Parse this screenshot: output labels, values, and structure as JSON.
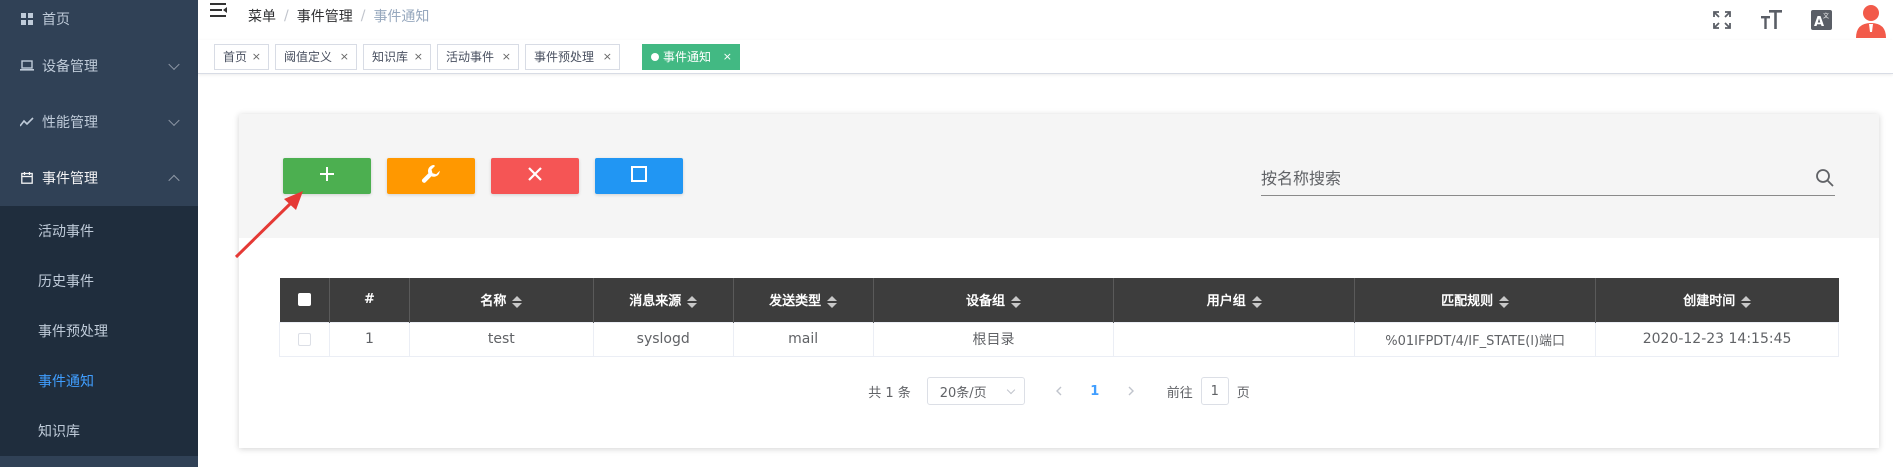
{
  "sidebar": {
    "items": [
      {
        "label": "首页",
        "icon": "dashboard-icon"
      },
      {
        "label": "设备管理",
        "icon": "laptop-icon"
      },
      {
        "label": "性能管理",
        "icon": "trend-chart-icon"
      },
      {
        "label": "事件管理",
        "icon": "calendar-icon"
      }
    ],
    "submenu": [
      {
        "label": "活动事件"
      },
      {
        "label": "历史事件"
      },
      {
        "label": "事件预处理"
      },
      {
        "label": "事件通知"
      },
      {
        "label": "知识库"
      }
    ]
  },
  "breadcrumb": {
    "menu": "菜单",
    "section": "事件管理",
    "current": "事件通知",
    "sep": "/"
  },
  "tags": [
    {
      "label": "首页"
    },
    {
      "label": "阈值定义"
    },
    {
      "label": "知识库"
    },
    {
      "label": "活动事件"
    },
    {
      "label": "事件预处理"
    },
    {
      "label": "事件通知"
    }
  ],
  "tag_close": "×",
  "search": {
    "placeholder": "按名称搜索"
  },
  "table": {
    "headers": [
      "#",
      "名称",
      "消息来源",
      "发送类型",
      "设备组",
      "用户组",
      "匹配规则",
      "创建时间"
    ],
    "rows": [
      [
        "1",
        "test",
        "syslogd",
        "mail",
        "根目录",
        "",
        "%01IFPDT/4/IF_STATE(l)端口",
        "2020-12-23 14:15:45"
      ]
    ]
  },
  "pagination": {
    "total": "共 1 条",
    "page_size": "20条/页",
    "current": "1",
    "goto_prefix": "前往",
    "goto_value": "1",
    "goto_suffix": "页"
  },
  "colors": {
    "sidebar_bg": "#304156",
    "active_tag": "#42b983",
    "add": "#4caf50",
    "edit": "#ff9800",
    "delete": "#f55555",
    "stop": "#2196f3",
    "annotation": "#e53935"
  }
}
